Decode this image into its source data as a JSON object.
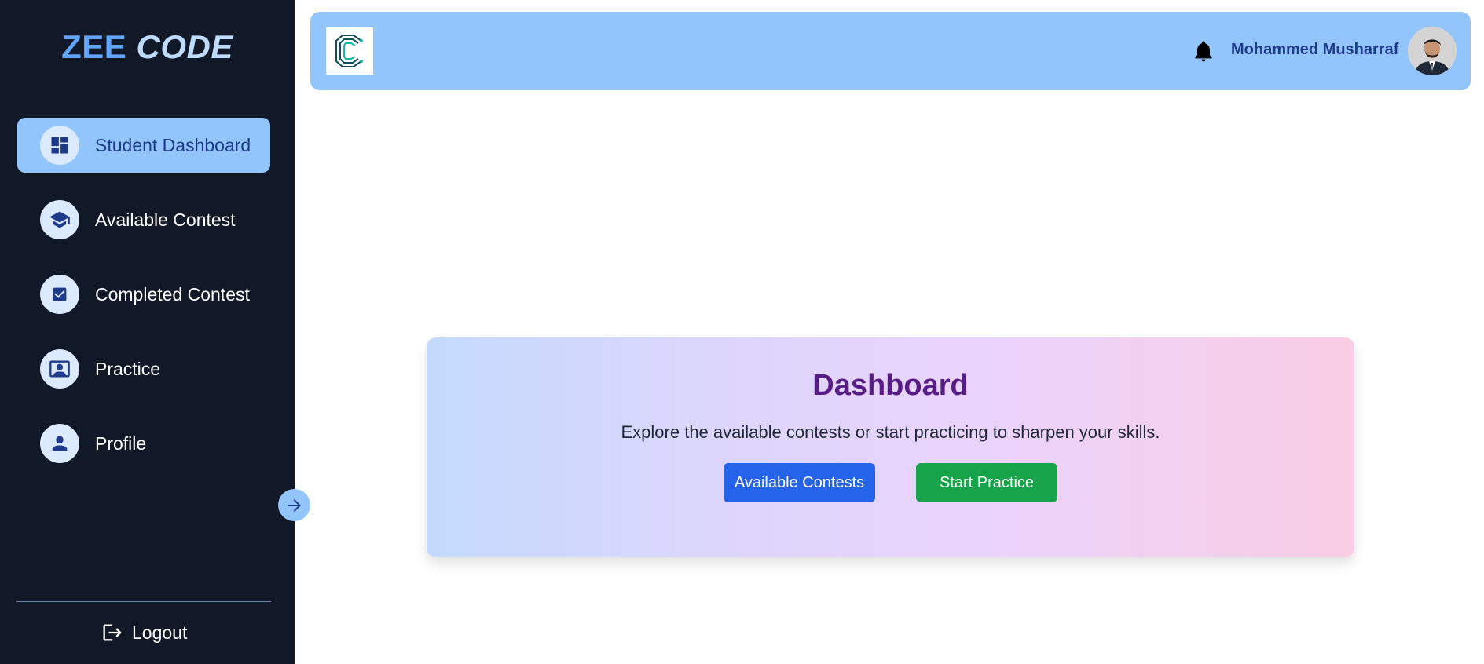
{
  "sidebar": {
    "brand_part1": "ZEE",
    "brand_part2": "CODE",
    "items": [
      {
        "label": "Student Dashboard",
        "icon": "dashboard-icon",
        "active": true
      },
      {
        "label": "Available Contest",
        "icon": "graduation-cap-icon",
        "active": false
      },
      {
        "label": "Completed Contest",
        "icon": "checkbox-icon",
        "active": false
      },
      {
        "label": "Practice",
        "icon": "presentation-icon",
        "active": false
      },
      {
        "label": "Profile",
        "icon": "user-icon",
        "active": false
      }
    ],
    "toggle_icon": "arrow-right-icon",
    "logout_label": "Logout"
  },
  "header": {
    "logo_icon": "code-logo",
    "notification_icon": "bell-icon",
    "user_name": "Mohammed Musharraf"
  },
  "dashboard": {
    "title": "Dashboard",
    "subtitle": "Explore the available contests or start practicing to sharpen your skills.",
    "primary_button": "Available Contests",
    "secondary_button": "Start Practice"
  },
  "colors": {
    "sidebar_bg": "#111827",
    "accent": "#93c5fd",
    "primary_button": "#2563eb",
    "secondary_button": "#16a34a",
    "title": "#581c87"
  }
}
